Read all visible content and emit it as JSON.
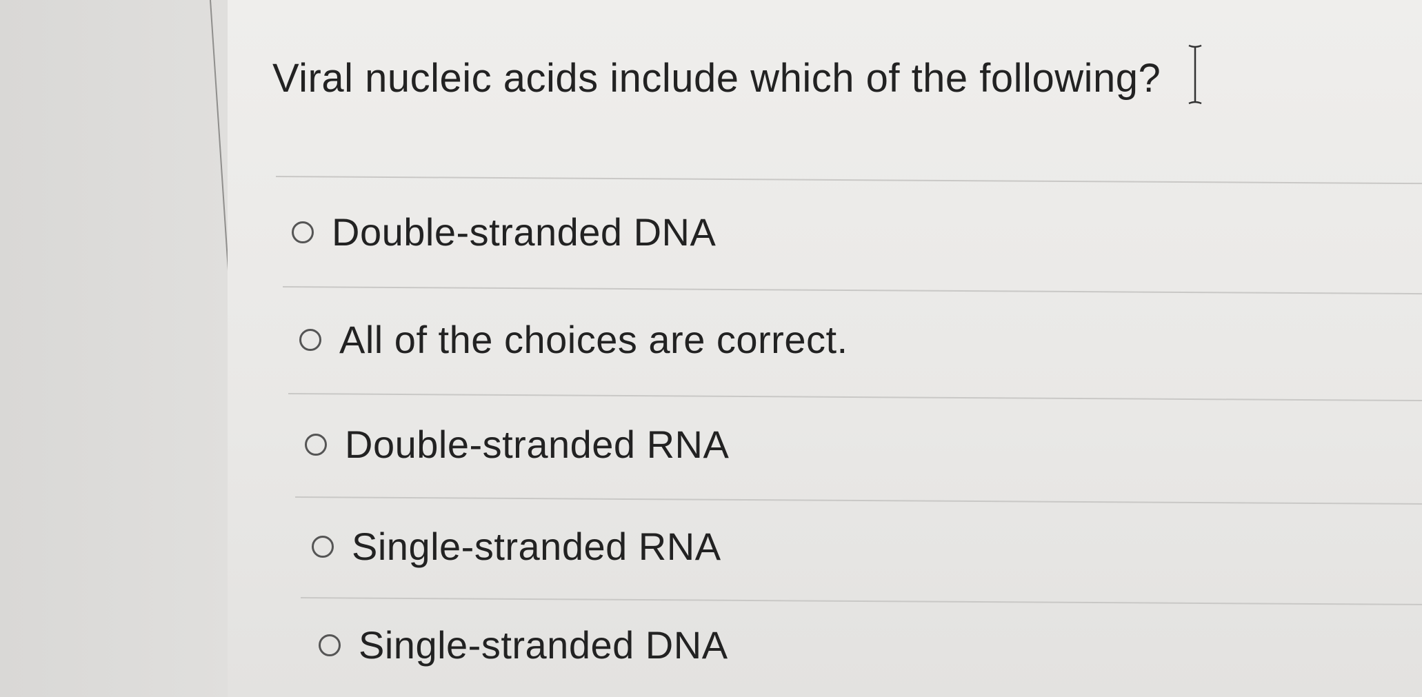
{
  "question": {
    "text": "Viral nucleic acids include which of the following?"
  },
  "options": [
    {
      "label": "Double-stranded DNA",
      "selected": false
    },
    {
      "label": "All of the choices are correct.",
      "selected": false
    },
    {
      "label": "Double-stranded RNA",
      "selected": false
    },
    {
      "label": "Single-stranded RNA",
      "selected": false
    },
    {
      "label": "Single-stranded DNA",
      "selected": false
    }
  ],
  "cursor": {
    "icon": "text-cursor-icon"
  },
  "colors": {
    "text": "#222222",
    "divider": "#c9c8c6",
    "radio_border": "#555555",
    "background": "#ecebe9"
  }
}
